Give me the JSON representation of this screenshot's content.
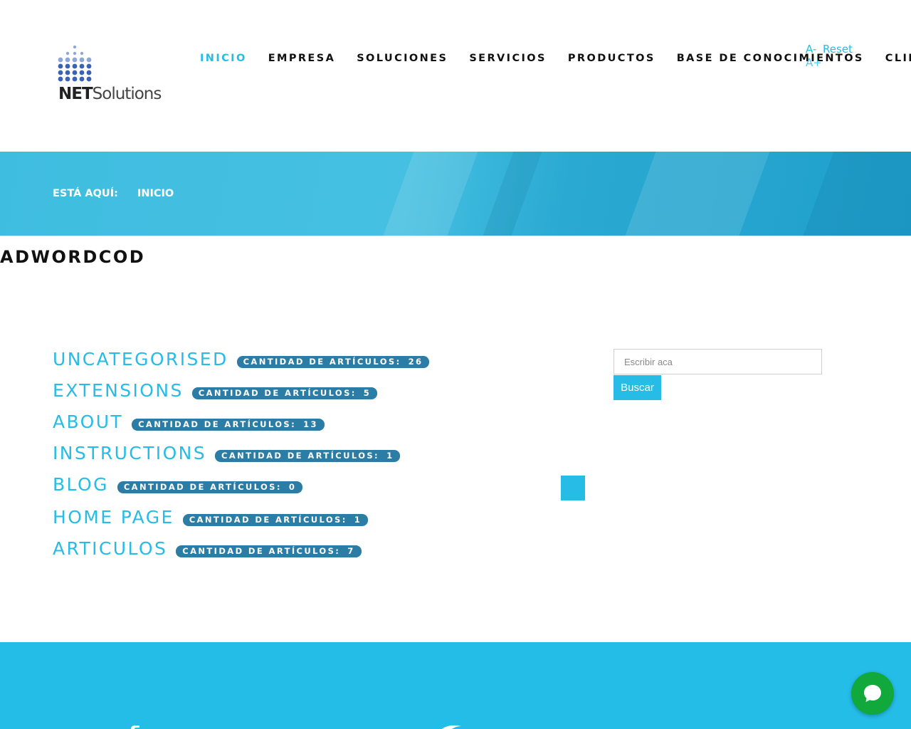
{
  "brand": {
    "logo_bold": "NET",
    "logo_regular": "Solutions"
  },
  "nav": [
    {
      "label": "INICIO",
      "active": true
    },
    {
      "label": "EMPRESA"
    },
    {
      "label": "SOLUCIONES"
    },
    {
      "label": "SERVICIOS"
    },
    {
      "label": "PRODUCTOS"
    },
    {
      "label": "BASE DE CONOCIMIENTOS"
    },
    {
      "label": "CLIENTES"
    }
  ],
  "font_controls": {
    "decrease": "A-",
    "reset": "Reset",
    "increase": "A+"
  },
  "breadcrumb": {
    "prefix": "ESTÁ AQUÍ:",
    "current": "INICIO"
  },
  "page_title": "ADWORDCOD",
  "categories": [
    {
      "name": "UNCATEGORISED",
      "badge_label": "CANTIDAD DE ARTÍCULOS:",
      "count": "26"
    },
    {
      "name": "EXTENSIONS",
      "badge_label": "CANTIDAD DE ARTÍCULOS:",
      "count": "5"
    },
    {
      "name": "ABOUT",
      "badge_label": "CANTIDAD DE ARTÍCULOS:",
      "count": "13"
    },
    {
      "name": "INSTRUCTIONS",
      "badge_label": "CANTIDAD DE ARTÍCULOS:",
      "count": "1"
    },
    {
      "name": "BLOG",
      "badge_label": "CANTIDAD DE ARTÍCULOS:",
      "count": "0"
    },
    {
      "name": "HOME PAGE",
      "badge_label": "CANTIDAD DE ARTÍCULOS:",
      "count": "1"
    },
    {
      "name": "ARTICULOS",
      "badge_label": "CANTIDAD DE ARTÍCULOS:",
      "count": "7"
    }
  ],
  "search": {
    "placeholder": "Escribir aca",
    "button_label": "Buscar"
  },
  "colors": {
    "accent": "#26bce6",
    "badge": "#2c7da6",
    "footer": "#24bde8",
    "chat": "#11a83c"
  },
  "icons": {
    "chat": "chat-bubble-icon",
    "logo_mark": "dot-grid-logo-icon"
  }
}
